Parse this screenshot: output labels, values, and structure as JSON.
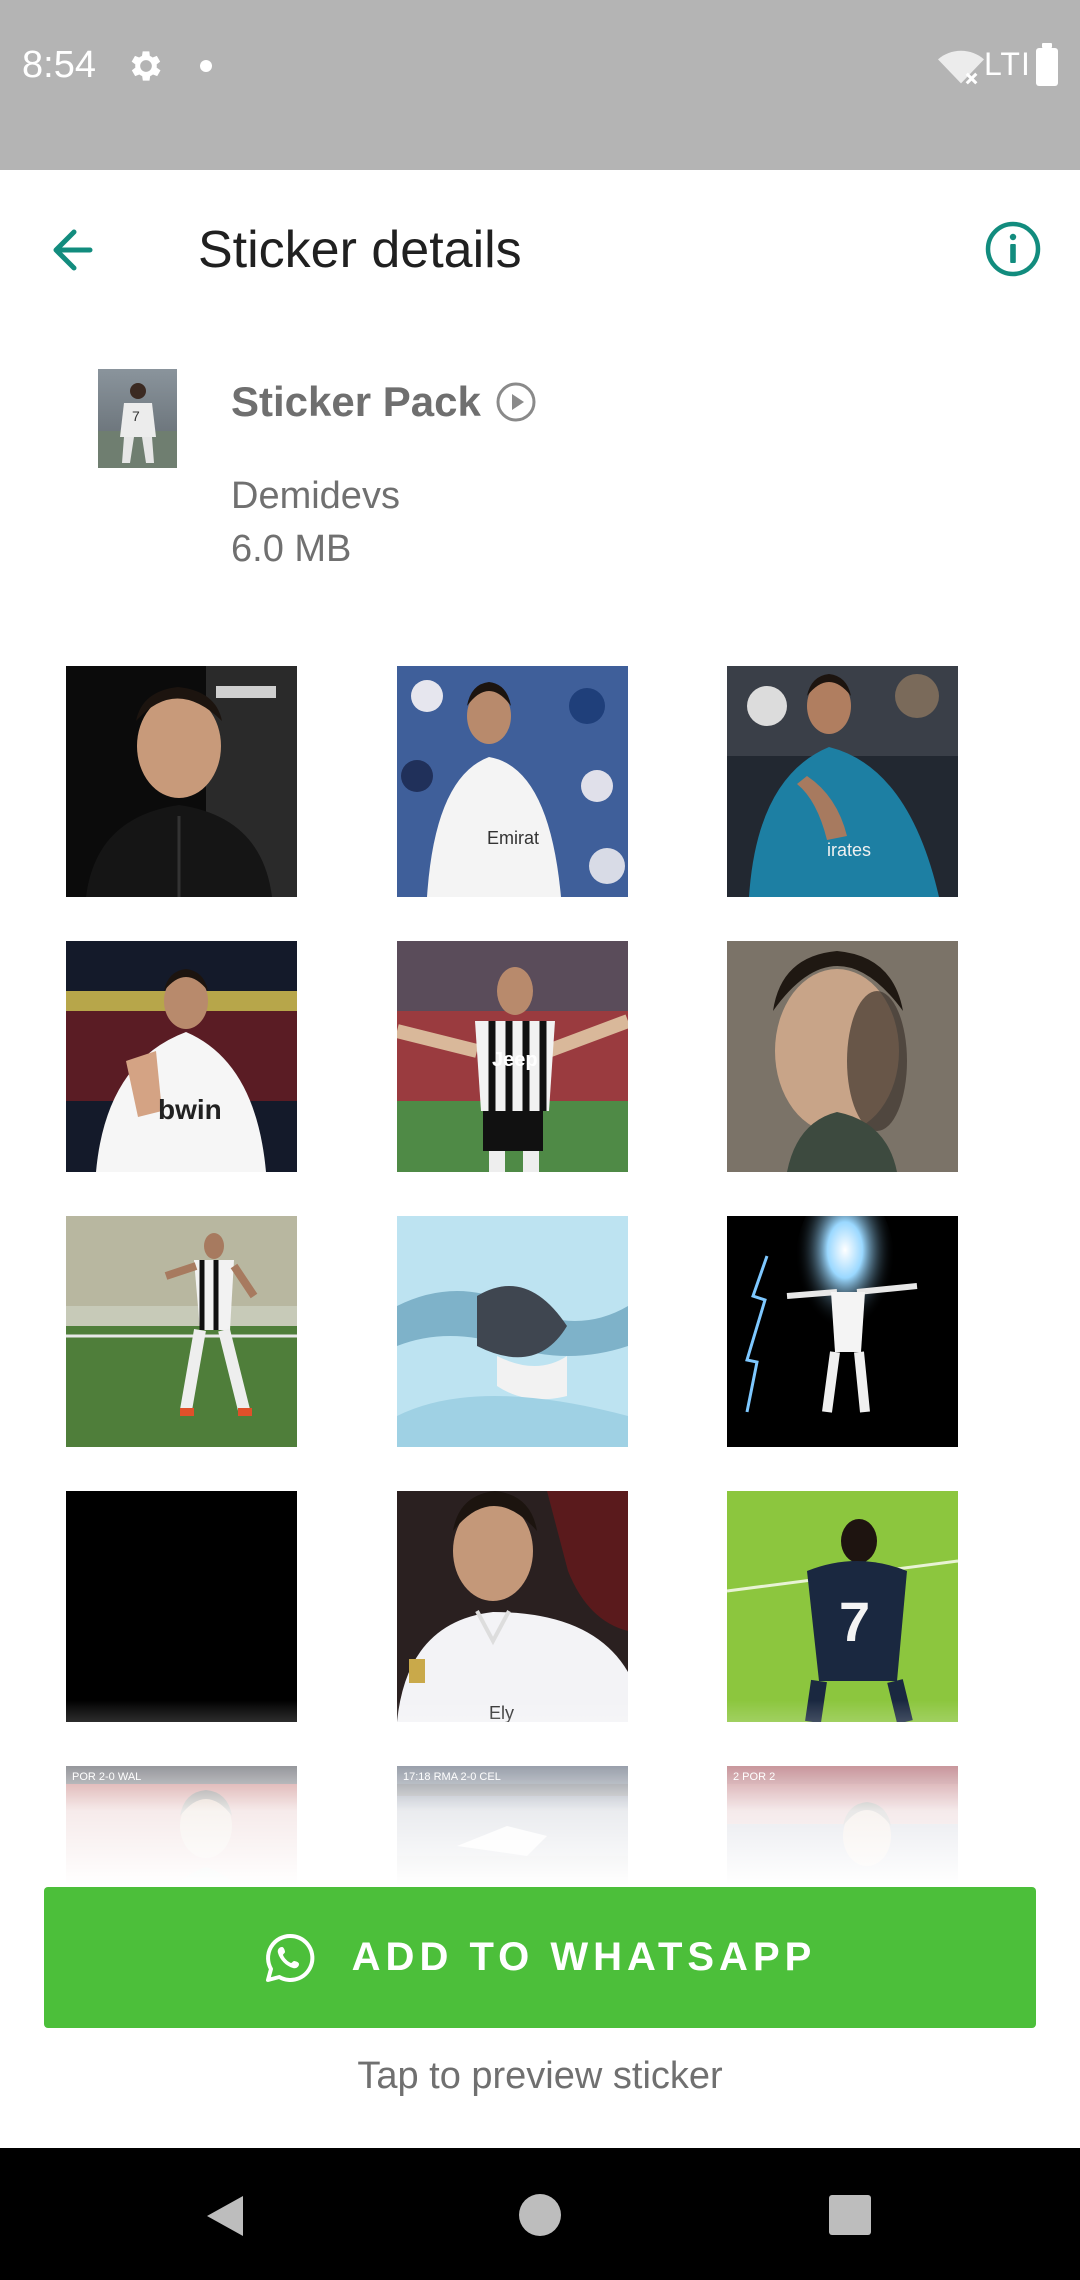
{
  "status_bar": {
    "time": "8:54",
    "network": "LTI"
  },
  "app_bar": {
    "title": "Sticker details"
  },
  "pack": {
    "name": "Sticker Pack",
    "author": "Demidevs",
    "size": "6.0 MB"
  },
  "button": {
    "label": "ADD TO WHATSAPP"
  },
  "hint": "Tap to preview sticker",
  "colors": {
    "accent": "#128C7E",
    "button": "#4CBF3A",
    "status_bar": "#B4B4B4"
  },
  "stickers": [
    {
      "desc": "portrait-dark-hoodie"
    },
    {
      "desc": "white-kit-stadium"
    },
    {
      "desc": "blue-kit-hand-on-chest"
    },
    {
      "desc": "white-kit-celebration-shout"
    },
    {
      "desc": "juventus-kit-arms-out"
    },
    {
      "desc": "close-up-portrait-grey"
    },
    {
      "desc": "juventus-kit-running-pitch"
    },
    {
      "desc": "blurred-light-blue"
    },
    {
      "desc": "lightning-celebration-black"
    },
    {
      "desc": "black-blank"
    },
    {
      "desc": "white-kit-close-up"
    },
    {
      "desc": "navy-kit-number-7-green-pitch"
    },
    {
      "desc": "portugal-red-crowd"
    },
    {
      "desc": "stadium-night-celebration"
    },
    {
      "desc": "portugal-close-up"
    }
  ]
}
